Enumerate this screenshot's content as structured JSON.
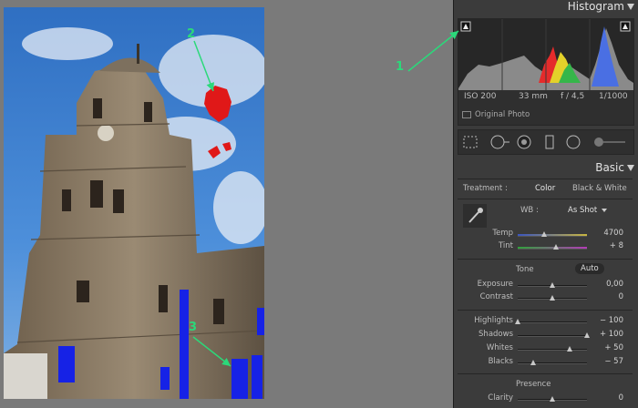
{
  "annotations": {
    "one": "1",
    "two": "2",
    "three": "3"
  },
  "histogram": {
    "title": "Histogram",
    "iso": "ISO 200",
    "focal": "33 mm",
    "aperture": "f / 4,5",
    "shutter": "1/1000",
    "original_photo_label": "Original Photo"
  },
  "basic": {
    "title": "Basic",
    "treatment_label": "Treatment :",
    "treatment_color": "Color",
    "treatment_bw": "Black & White",
    "wb_label": "WB :",
    "wb_value": "As Shot",
    "temp": {
      "label": "Temp",
      "value": "4700",
      "pos": 0.38
    },
    "tint": {
      "label": "Tint",
      "value": "+ 8",
      "pos": 0.55
    },
    "tone_label": "Tone",
    "auto_label": "Auto",
    "exposure": {
      "label": "Exposure",
      "value": "0,00",
      "pos": 0.5
    },
    "contrast": {
      "label": "Contrast",
      "value": "0",
      "pos": 0.5
    },
    "highlights": {
      "label": "Highlights",
      "value": "− 100",
      "pos": 0.0
    },
    "shadows": {
      "label": "Shadows",
      "value": "+ 100",
      "pos": 1.0
    },
    "whites": {
      "label": "Whites",
      "value": "+ 50",
      "pos": 0.75
    },
    "blacks": {
      "label": "Blacks",
      "value": "− 57",
      "pos": 0.22
    },
    "presence_label": "Presence",
    "clarity": {
      "label": "Clarity",
      "value": "0",
      "pos": 0.5
    }
  }
}
